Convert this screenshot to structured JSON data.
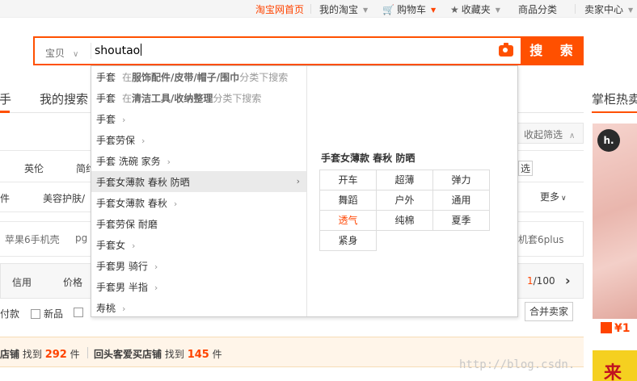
{
  "topbar": {
    "home": "淘宝网首页",
    "my_taobao": "我的淘宝",
    "cart": "购物车",
    "favorites": "收藏夹",
    "categories": "商品分类",
    "seller_center": "卖家中心"
  },
  "search": {
    "scope": "宝贝",
    "query": "shoutao",
    "button": "搜 索"
  },
  "tabs": {
    "first_partial": "手",
    "my_search": "我的搜索",
    "right_title": "掌柜热卖"
  },
  "filters": {
    "collapse": "收起筛选",
    "row1_a": "英伦",
    "row1_b": "简约",
    "row1_right": "选",
    "row2_a": "件",
    "row2_b": "美容护肤/",
    "row2_more": "更多",
    "row3_a": "苹果6手机壳",
    "row3_b": "pg",
    "row3_right": "机套6plus"
  },
  "sortbar": {
    "credit": "信用",
    "price": "价格",
    "page_current": "1",
    "page_total": "/100",
    "next": "›",
    "pay": "付款",
    "new": "新品",
    "merge": "合并卖家"
  },
  "shopbar": {
    "prefix": "店铺",
    "found1": "找到",
    "count1": "292",
    "unit1": "件",
    "label2": "回头客爱买店铺",
    "found2": "找到",
    "count2": "145",
    "unit2": "件"
  },
  "right_product": {
    "logo": "h.",
    "price": "¥1",
    "banner": "来"
  },
  "suggestions": [
    {
      "term": "手套",
      "prefix": "在",
      "category": "服饰配件/皮带/帽子/围巾",
      "suffix": "分类下搜索",
      "type": "category"
    },
    {
      "term": "手套",
      "prefix": "在",
      "category": "清洁工具/收纳整理",
      "suffix": "分类下搜索",
      "type": "category"
    },
    {
      "term": "手套",
      "type": "expand"
    },
    {
      "term": "手套劳保",
      "type": "expand"
    },
    {
      "term": "手套 洗碗 家务",
      "type": "expand"
    },
    {
      "term": "手套女薄款 春秋 防晒",
      "type": "active"
    },
    {
      "term": "手套女薄款 春秋",
      "type": "expand"
    },
    {
      "term": "手套劳保 耐磨",
      "type": "plain"
    },
    {
      "term": "手套女",
      "type": "expand"
    },
    {
      "term": "手套男 骑行",
      "type": "expand"
    },
    {
      "term": "手套男 半指",
      "type": "expand"
    },
    {
      "term": "寿桃",
      "type": "expand"
    }
  ],
  "attr_panel": {
    "title": "手套女薄款 春秋 防晒",
    "attrs": [
      "开车",
      "超薄",
      "弹力",
      "舞蹈",
      "户外",
      "通用",
      "透气",
      "纯棉",
      "夏季",
      "紧身"
    ],
    "highlighted": "透气"
  },
  "watermark": "http://blog.csdn.",
  "colors": {
    "accent": "#ff5000",
    "link_orange": "#f40"
  }
}
